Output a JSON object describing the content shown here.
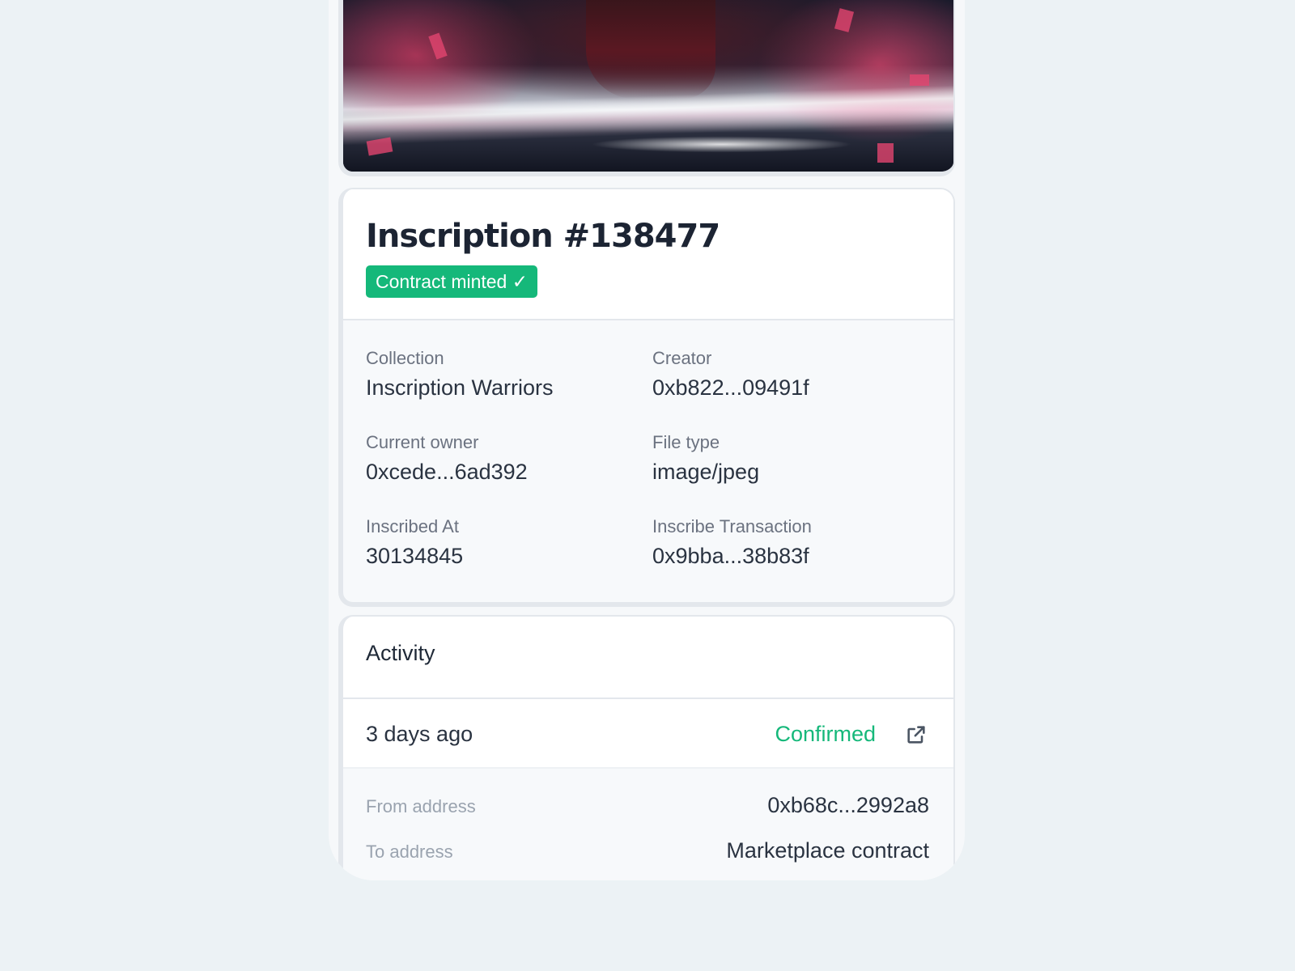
{
  "inscription": {
    "title": "Inscription #138477",
    "badge": "Contract minted ✓"
  },
  "details": [
    {
      "label": "Collection",
      "value": "Inscription Warriors"
    },
    {
      "label": "Creator",
      "value": "0xb822...09491f"
    },
    {
      "label": "Current owner",
      "value": "0xcede...6ad392"
    },
    {
      "label": "File type",
      "value": "image/jpeg"
    },
    {
      "label": "Inscribed At",
      "value": "30134845"
    },
    {
      "label": "Inscribe Transaction",
      "value": "0x9bba...38b83f"
    }
  ],
  "activity": {
    "heading": "Activity",
    "entry": {
      "time": "3 days ago",
      "status": "Confirmed",
      "status_color": "#15b87a",
      "link_icon": "external-link-icon",
      "from_label": "From address",
      "from_value": "0xb68c...2992a8",
      "to_label": "To address",
      "to_value": "Marketplace contract"
    }
  },
  "colors": {
    "accent": "#15b87a",
    "background": "#ecf2f5"
  }
}
